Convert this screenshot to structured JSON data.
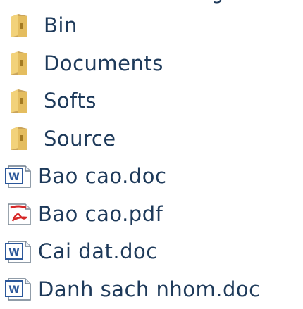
{
  "partial_top_text": "favorites shortcuts images",
  "files": [
    {
      "name": "Bin",
      "icon": "folder-icon"
    },
    {
      "name": "Documents",
      "icon": "folder-icon"
    },
    {
      "name": "Softs",
      "icon": "folder-icon"
    },
    {
      "name": "Source",
      "icon": "folder-icon"
    },
    {
      "name": "Bao cao.doc",
      "icon": "word-document-icon"
    },
    {
      "name": "Bao cao.pdf",
      "icon": "pdf-document-icon"
    },
    {
      "name": "Cai dat.doc",
      "icon": "word-document-icon"
    },
    {
      "name": "Danh sach nhom.doc",
      "icon": "word-document-icon"
    }
  ],
  "colors": {
    "text": "#1e3a5a",
    "folder": "#e8c36a",
    "folder_dark": "#b88a2a",
    "word": "#2b579a",
    "pdf": "#d62828"
  }
}
